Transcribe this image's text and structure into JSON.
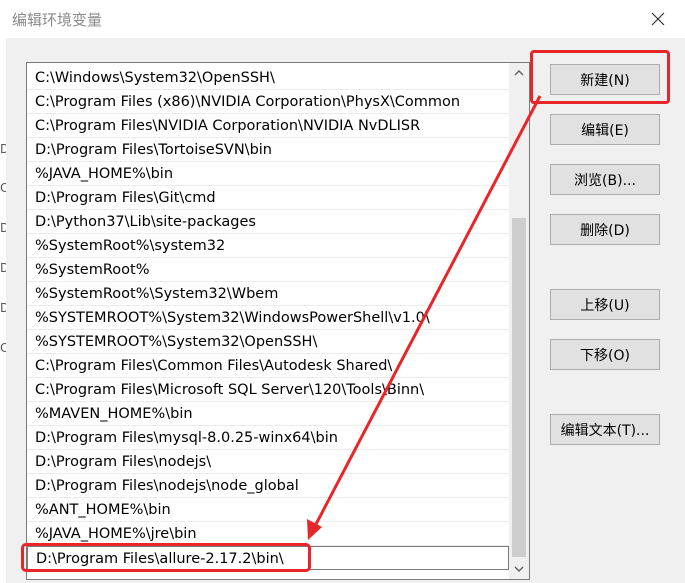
{
  "window": {
    "title": "编辑环境变量",
    "close_icon": "close-icon"
  },
  "path_list": {
    "items": [
      "C:\\Windows\\System32\\OpenSSH\\",
      "C:\\Program Files (x86)\\NVIDIA Corporation\\PhysX\\Common",
      "C:\\Program Files\\NVIDIA Corporation\\NVIDIA NvDLISR",
      "D:\\Program Files\\TortoiseSVN\\bin",
      "%JAVA_HOME%\\bin",
      "D:\\Program Files\\Git\\cmd",
      "D:\\Python37\\Lib\\site-packages",
      "%SystemRoot%\\system32",
      "%SystemRoot%",
      "%SystemRoot%\\System32\\Wbem",
      "%SYSTEMROOT%\\System32\\WindowsPowerShell\\v1.0\\",
      "%SYSTEMROOT%\\System32\\OpenSSH\\",
      "C:\\Program Files\\Common Files\\Autodesk Shared\\",
      "C:\\Program Files\\Microsoft SQL Server\\120\\Tools\\Binn\\",
      "%MAVEN_HOME%\\bin",
      "D:\\Program Files\\mysql-8.0.25-winx64\\bin",
      "D:\\Program Files\\nodejs\\",
      "D:\\Program Files\\nodejs\\node_global",
      "%ANT_HOME%\\bin",
      "%JAVA_HOME%\\jre\\bin",
      "D:\\Program Files\\allure-2.17.2\\bin\\"
    ],
    "selected_index": 20
  },
  "buttons": {
    "new": "新建(N)",
    "edit": "编辑(E)",
    "browse": "浏览(B)...",
    "delete": "删除(D)",
    "move_up": "上移(U)",
    "move_down": "下移(O)",
    "edit_text": "编辑文本(T)..."
  },
  "background_fragments": [
    "D",
    "C",
    "D",
    "D",
    "D",
    "C"
  ],
  "colors": {
    "annotation_red": "#e8262a",
    "button_face": "#e1e1e1",
    "dialog_bg": "#f0f0f0"
  }
}
